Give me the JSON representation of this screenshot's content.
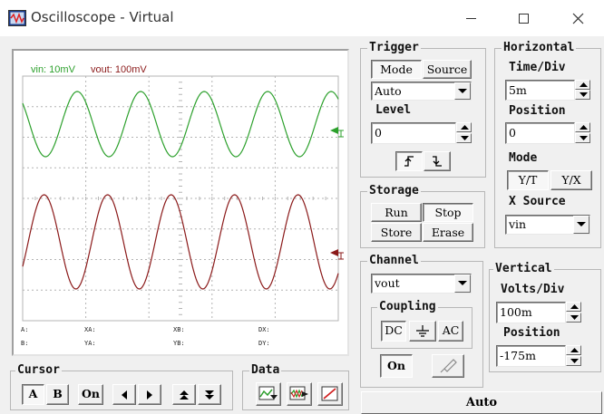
{
  "window": {
    "title": "Oscilloscope - Virtual"
  },
  "scope": {
    "legend_vin": "vin: 10mV",
    "legend_vout": "vout: 100mV",
    "colors": {
      "vin": "#2ca02c",
      "vout": "#8b1a1a",
      "grid": "#b4b4b4"
    },
    "readouts": {
      "a": "A:",
      "b": "B:",
      "xa": "XA:",
      "ya": "YA:",
      "xb": "XB:",
      "yb": "YB:",
      "dx": "DX:",
      "dy": "DY:"
    }
  },
  "trigger": {
    "title": "Trigger",
    "mode_label": "Mode",
    "source_label": "Source",
    "mode_value": "Auto",
    "level_label": "Level",
    "level_value": "0"
  },
  "horizontal": {
    "title": "Horizontal",
    "time_div_label": "Time/Div",
    "time_div_value": "5m",
    "position_label": "Position",
    "position_value": "0",
    "mode_label": "Mode",
    "yt_label": "Y/T",
    "yx_label": "Y/X",
    "x_source_label": "X Source",
    "x_source_value": "vin"
  },
  "storage": {
    "title": "Storage",
    "run_label": "Run",
    "stop_label": "Stop",
    "store_label": "Store",
    "erase_label": "Erase"
  },
  "channel": {
    "title": "Channel",
    "value": "vout",
    "coupling_label": "Coupling",
    "dc_label": "DC",
    "ac_label": "AC",
    "on_label": "On"
  },
  "vertical": {
    "title": "Vertical",
    "volts_div_label": "Volts/Div",
    "volts_div_value": "100m",
    "position_label": "Position",
    "position_value": "-175m"
  },
  "cursor": {
    "title": "Cursor",
    "a_label": "A",
    "b_label": "B",
    "on_label": "On"
  },
  "data": {
    "title": "Data"
  },
  "auto_button": {
    "label": "Auto"
  }
}
